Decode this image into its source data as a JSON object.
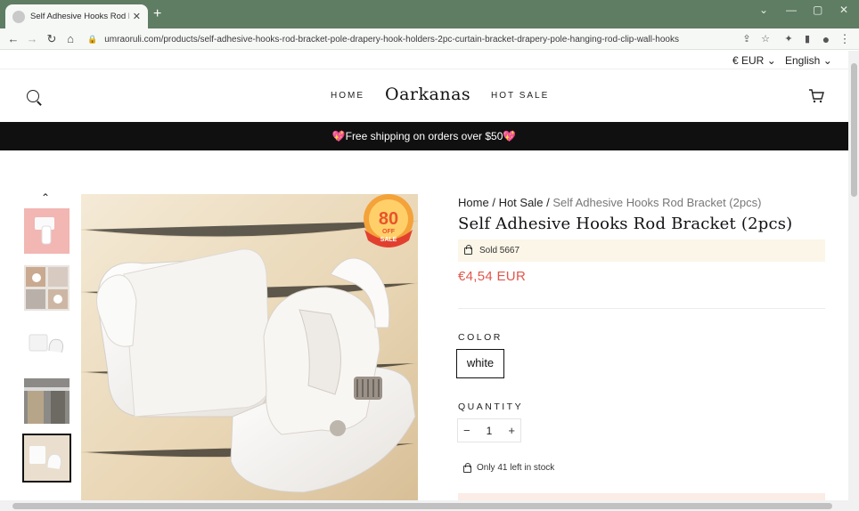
{
  "browser": {
    "tab_title": "Self Adhesive Hooks Rod Bracket",
    "url": "umraoruli.com/products/self-adhesive-hooks-rod-bracket-pole-drapery-hook-holders-2pc-curtain-bracket-drapery-pole-hanging-rod-clip-wall-hooks",
    "tab_close_glyph": "✕",
    "new_tab_glyph": "+",
    "back_glyph": "←",
    "forward_glyph": "→",
    "reload_glyph": "↻",
    "home_glyph": "⌂",
    "lock_glyph": "🔒",
    "share_glyph": "⇪",
    "star_glyph": "☆",
    "extensions_glyph": "✦",
    "sidepanel_glyph": "▮",
    "profile_glyph": "●",
    "menu_glyph": "⋮",
    "minimize_glyph": "—",
    "maximize_glyph": "▢",
    "close_glyph": "✕",
    "collapse_glyph": "⌄"
  },
  "header": {
    "currency": "€ EUR",
    "language": "English",
    "nav_left": "HOME",
    "logo": "Oarkanas",
    "nav_right": "HOT SALE"
  },
  "banner": {
    "heart": "💖",
    "text": "Free shipping on orders over $50"
  },
  "gallery": {
    "up_arrow": "⌃",
    "badge_number": "80",
    "badge_off": "OFF",
    "badge_sale": "SALE"
  },
  "product": {
    "breadcrumb": {
      "home": "Home",
      "sep": "/",
      "category": "Hot Sale",
      "current": "Self Adhesive Hooks Rod Bracket (2pcs)"
    },
    "title": "Self Adhesive Hooks Rod Bracket (2pcs)",
    "sold": "Sold 5667",
    "price": "€4,54 EUR",
    "color_label": "COLOR",
    "color_value": "white",
    "quantity_label": "QUANTITY",
    "quantity": "1",
    "minus": "−",
    "plus": "+",
    "stock": "Only 41 left in stock"
  },
  "colors": {
    "price": "#e2574c",
    "banner_bg": "#101010",
    "chrome": "#5f7d63"
  }
}
